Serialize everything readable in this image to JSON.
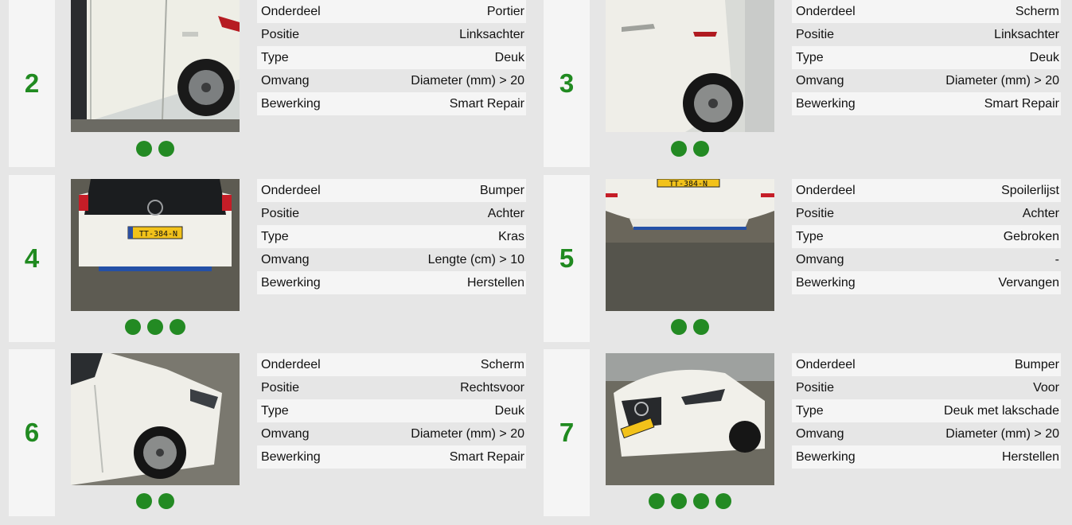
{
  "labels": {
    "part": "Onderdeel",
    "position": "Positie",
    "type": "Type",
    "extent": "Omvang",
    "treatment": "Bewerking"
  },
  "colors": {
    "number": "#208a20",
    "dot": "#238a23",
    "background": "#e6e6e6"
  },
  "damages": [
    {
      "number": "2",
      "part": "Portier",
      "position": "Linksachter",
      "type": "Deuk",
      "extent": "Diameter (mm) > 20",
      "treatment": "Smart Repair",
      "photo_count": 2,
      "photo_subject": "rear-left door dent"
    },
    {
      "number": "3",
      "part": "Scherm",
      "position": "Linksachter",
      "type": "Deuk",
      "extent": "Diameter (mm) > 20",
      "treatment": "Smart Repair",
      "photo_count": 2,
      "photo_subject": "rear-left fender wheel"
    },
    {
      "number": "4",
      "part": "Bumper",
      "position": "Achter",
      "type": "Kras",
      "extent": "Lengte (cm) > 10",
      "treatment": "Herstellen",
      "photo_count": 3,
      "photo_subject": "rear view with license plate",
      "plate": "TT-384-N"
    },
    {
      "number": "5",
      "part": "Spoilerlijst",
      "position": "Achter",
      "type": "Gebroken",
      "extent": "-",
      "treatment": "Vervangen",
      "photo_count": 2,
      "photo_subject": "rear bumper lower spoiler",
      "plate": "TT-384-N"
    },
    {
      "number": "6",
      "part": "Scherm",
      "position": "Rechtsvoor",
      "type": "Deuk",
      "extent": "Diameter (mm) > 20",
      "treatment": "Smart Repair",
      "photo_count": 2,
      "photo_subject": "front-right fender wheel"
    },
    {
      "number": "7",
      "part": "Bumper",
      "position": "Voor",
      "type": "Deuk met lakschade",
      "extent": "Diameter (mm) > 20",
      "treatment": "Herstellen",
      "photo_count": 4,
      "photo_subject": "front view of white car",
      "plate": "TT-384-N"
    }
  ]
}
